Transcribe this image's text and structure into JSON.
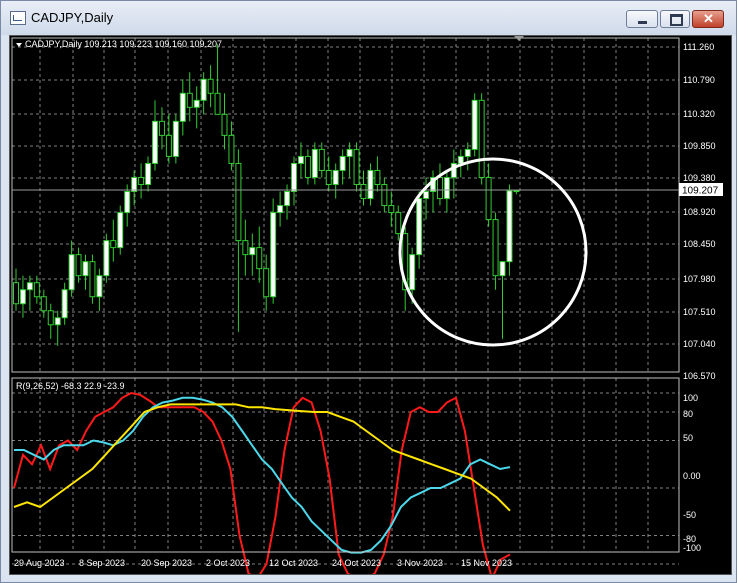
{
  "window": {
    "title": "CADJPY,Daily"
  },
  "main_panel": {
    "info": "CADJPY,Daily  109.213 109.223 109.160 109.207",
    "price_label": "109.207",
    "yticks": [
      "111.260",
      "110.790",
      "110.320",
      "109.850",
      "109.380",
      "108.920",
      "108.450",
      "107.980",
      "107.510",
      "107.040",
      "106.570"
    ]
  },
  "indicator_panel": {
    "info": "R(9,26,52) -68.3 22.9 -23.9",
    "yticks": [
      "100",
      "80",
      "50",
      "0.00",
      "-50",
      "-80",
      "-100"
    ]
  },
  "x_axis": {
    "labels": [
      "29 Aug 2023",
      "8 Sep 2023",
      "20 Sep 2023",
      "2 Oct 2023",
      "12 Oct 2023",
      "24 Oct 2023",
      "3 Nov 2023",
      "15 Nov 2023"
    ]
  },
  "colors": {
    "background": "#000000",
    "grid": "#7f7f7f",
    "candle": "#32cd32",
    "bull_fill": "#ffffff",
    "red_line": "#ff1a1a",
    "cyan_line": "#4ad8ea",
    "yellow_line": "#ffe600",
    "annotation_circle": "#ffffff"
  },
  "chart_data": [
    {
      "type": "candlestick",
      "title": "CADJPY,Daily",
      "ohlc_last": {
        "open": 109.213,
        "high": 109.223,
        "low": 109.16,
        "close": 109.207
      },
      "ylim": [
        106.5,
        111.4
      ],
      "grid": true,
      "candles": [
        [
          107.9,
          108.1,
          107.5,
          107.6
        ],
        [
          107.6,
          108.0,
          107.4,
          107.8
        ],
        [
          107.8,
          108.0,
          107.5,
          107.9
        ],
        [
          107.9,
          108.0,
          107.6,
          107.7
        ],
        [
          107.7,
          107.8,
          107.4,
          107.5
        ],
        [
          107.5,
          107.6,
          107.1,
          107.3
        ],
        [
          107.3,
          107.5,
          107.0,
          107.4
        ],
        [
          107.4,
          107.9,
          107.3,
          107.8
        ],
        [
          107.8,
          108.5,
          107.7,
          108.3
        ],
        [
          108.3,
          108.4,
          107.9,
          108.0
        ],
        [
          108.0,
          108.3,
          107.8,
          108.2
        ],
        [
          108.2,
          108.3,
          107.6,
          107.7
        ],
        [
          107.7,
          108.1,
          107.5,
          108.0
        ],
        [
          108.0,
          108.6,
          107.9,
          108.5
        ],
        [
          108.5,
          108.8,
          108.2,
          108.4
        ],
        [
          108.4,
          109.0,
          108.3,
          108.9
        ],
        [
          108.9,
          109.3,
          108.7,
          109.2
        ],
        [
          109.2,
          109.5,
          109.0,
          109.4
        ],
        [
          109.4,
          109.6,
          109.1,
          109.3
        ],
        [
          109.3,
          109.7,
          109.2,
          109.6
        ],
        [
          109.6,
          110.5,
          109.5,
          110.2
        ],
        [
          110.2,
          110.4,
          109.8,
          110.0
        ],
        [
          110.0,
          110.3,
          109.6,
          109.7
        ],
        [
          109.7,
          110.3,
          109.6,
          110.2
        ],
        [
          110.2,
          110.8,
          110.0,
          110.6
        ],
        [
          110.6,
          110.9,
          110.2,
          110.4
        ],
        [
          110.4,
          110.7,
          110.1,
          110.5
        ],
        [
          110.5,
          110.9,
          110.3,
          110.8
        ],
        [
          110.8,
          111.0,
          110.4,
          110.6
        ],
        [
          110.6,
          111.3,
          110.4,
          110.3
        ],
        [
          110.3,
          110.6,
          109.8,
          110.0
        ],
        [
          110.0,
          110.2,
          109.5,
          109.6
        ],
        [
          109.6,
          109.8,
          107.2,
          108.5
        ],
        [
          108.5,
          108.8,
          108.0,
          108.3
        ],
        [
          108.3,
          108.6,
          108.0,
          108.4
        ],
        [
          108.4,
          108.7,
          107.9,
          108.1
        ],
        [
          108.1,
          108.3,
          107.5,
          107.7
        ],
        [
          107.7,
          109.1,
          107.6,
          108.9
        ],
        [
          108.9,
          109.2,
          108.7,
          109.0
        ],
        [
          109.0,
          109.3,
          108.8,
          109.2
        ],
        [
          109.2,
          109.7,
          109.0,
          109.6
        ],
        [
          109.6,
          109.9,
          109.4,
          109.7
        ],
        [
          109.7,
          109.8,
          109.3,
          109.4
        ],
        [
          109.4,
          109.9,
          109.3,
          109.8
        ],
        [
          109.8,
          109.9,
          109.4,
          109.5
        ],
        [
          109.5,
          109.7,
          109.2,
          109.3
        ],
        [
          109.3,
          109.6,
          109.1,
          109.5
        ],
        [
          109.5,
          109.8,
          109.3,
          109.7
        ],
        [
          109.7,
          109.9,
          109.4,
          109.8
        ],
        [
          109.8,
          109.9,
          109.2,
          109.3
        ],
        [
          109.3,
          109.5,
          109.0,
          109.1
        ],
        [
          109.1,
          109.6,
          109.0,
          109.5
        ],
        [
          109.5,
          109.7,
          109.2,
          109.3
        ],
        [
          109.3,
          109.4,
          108.9,
          109.0
        ],
        [
          109.0,
          109.2,
          108.7,
          108.9
        ],
        [
          108.9,
          109.0,
          108.5,
          108.6
        ],
        [
          108.6,
          108.7,
          107.5,
          107.8
        ],
        [
          107.8,
          108.4,
          107.6,
          108.3
        ],
        [
          108.3,
          109.2,
          108.1,
          109.1
        ],
        [
          109.1,
          109.4,
          108.8,
          109.2
        ],
        [
          109.2,
          109.5,
          108.9,
          109.4
        ],
        [
          109.4,
          109.6,
          109.0,
          109.1
        ],
        [
          109.1,
          109.5,
          108.9,
          109.4
        ],
        [
          109.4,
          109.8,
          109.1,
          109.6
        ],
        [
          109.6,
          109.8,
          109.4,
          109.7
        ],
        [
          109.7,
          109.9,
          109.5,
          109.8
        ],
        [
          109.8,
          110.6,
          109.7,
          110.5
        ],
        [
          110.5,
          110.6,
          109.3,
          109.4
        ],
        [
          109.4,
          109.6,
          108.7,
          108.8
        ],
        [
          108.8,
          108.9,
          107.8,
          108.0
        ],
        [
          108.0,
          108.2,
          107.1,
          108.2
        ],
        [
          108.2,
          109.3,
          108.0,
          109.21
        ],
        [
          109.213,
          109.223,
          109.16,
          109.207
        ]
      ]
    },
    {
      "type": "line",
      "title": "R(9,26,52)",
      "last_values": [
        -68.3,
        22.9,
        -23.9
      ],
      "ylim": [
        -100,
        100
      ],
      "grid": true,
      "series": [
        {
          "color": "#ff1a1a",
          "values": [
            0,
            35,
            25,
            45,
            20,
            45,
            50,
            40,
            60,
            75,
            80,
            85,
            95,
            100,
            98,
            92,
            85,
            85,
            85,
            85,
            85,
            80,
            70,
            50,
            20,
            -50,
            -90,
            -95,
            -80,
            -30,
            40,
            85,
            95,
            90,
            60,
            10,
            -70,
            -90,
            -95,
            -95,
            -90,
            -70,
            -30,
            40,
            80,
            85,
            80,
            80,
            90,
            95,
            60,
            0,
            -60,
            -95,
            -75,
            -70
          ]
        },
        {
          "color": "#4ad8ea",
          "values": [
            40,
            40,
            35,
            30,
            40,
            45,
            45,
            45,
            50,
            48,
            45,
            50,
            60,
            75,
            85,
            90,
            92,
            95,
            95,
            93,
            90,
            85,
            75,
            60,
            45,
            30,
            20,
            5,
            -10,
            -20,
            -35,
            -45,
            -55,
            -65,
            -68,
            -68,
            -65,
            -55,
            -40,
            -20,
            -10,
            -5,
            0,
            0,
            5,
            10,
            25,
            30,
            25,
            20,
            22
          ]
        },
        {
          "color": "#ffe600",
          "values": [
            -20,
            -15,
            -20,
            -10,
            0,
            10,
            20,
            35,
            50,
            65,
            80,
            85,
            88,
            88,
            88,
            88,
            88,
            88,
            85,
            85,
            83,
            82,
            81,
            80,
            80,
            75,
            70,
            60,
            50,
            40,
            35,
            30,
            25,
            20,
            15,
            10,
            0,
            -10,
            -23.9
          ]
        }
      ]
    }
  ]
}
